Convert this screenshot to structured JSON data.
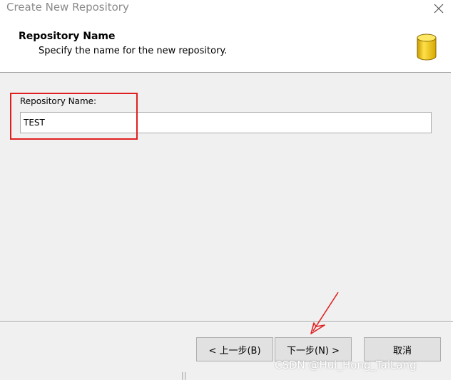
{
  "window": {
    "title": "Create New Repository"
  },
  "header": {
    "title": "Repository Name",
    "subtitle": "Specify the name for the new repository."
  },
  "form": {
    "repository_name_label": "Repository Name:",
    "repository_name_value": "TEST"
  },
  "buttons": {
    "back_label": "< 上一步(B)",
    "next_label": "下一步(N) >",
    "cancel_label": "取消"
  },
  "watermark": {
    "text": "CSDN @Hui_Hong_TaiLang"
  },
  "icons": {
    "close": "close-icon",
    "database": "database-icon"
  },
  "colors": {
    "highlight": "#e02020",
    "icon_yellow": "#f2c200"
  }
}
